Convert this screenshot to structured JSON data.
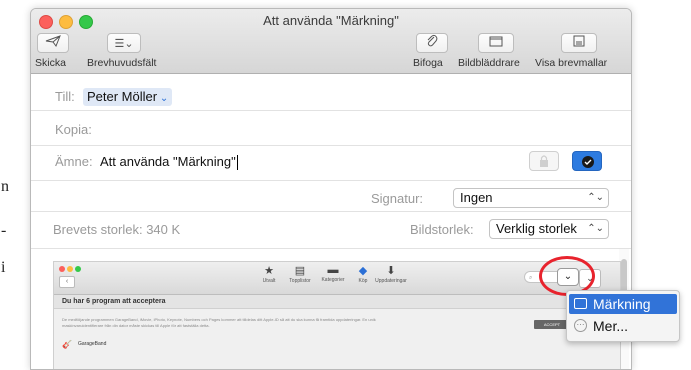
{
  "background_text": [
    "n",
    "-",
    "i"
  ],
  "window": {
    "title": "Att använda \"Märkning\"",
    "toolbar": {
      "send_label": "Skicka",
      "header_fields_label": "Brevhuvudsfält",
      "attach_label": "Bifoga",
      "photo_browser_label": "Bildbläddrare",
      "templates_label": "Visa brevmallar"
    }
  },
  "compose": {
    "to_label": "Till:",
    "to_value": "Peter Möller",
    "cc_label": "Kopia:",
    "subject_label": "Ämne:",
    "subject_value": "Att använda \"Märkning\"",
    "signature_label": "Signatur:",
    "signature_value": "Ingen",
    "size_label": "Brevets storlek: 340 K",
    "image_size_label": "Bildstorlek:",
    "image_size_value": "Verklig storlek"
  },
  "preview": {
    "tabs": [
      "Utvalt",
      "Topplistor",
      "Kategorier",
      "Köp",
      "Uppdateringar"
    ],
    "banner": "Du har 6 program att acceptera",
    "body": "De medföljande programmen GarageBand, iMovie, iPhoto, Keynote, Numbers och Pages kommer att tilldelas ditt Apple-ID så att du ska kunna få framtida uppdateringar. En unik maskinvaruidentifierare från din dator måste skickas till Apple för att fastställa detta.",
    "accept": "ACCEPT",
    "app": "GarageBand"
  },
  "markup_menu": {
    "items": [
      "Märkning",
      "Mer..."
    ]
  },
  "colors": {
    "highlight": "#3173d8",
    "annotation_red": "#e8232d",
    "markup_button": "#2d7be0"
  }
}
